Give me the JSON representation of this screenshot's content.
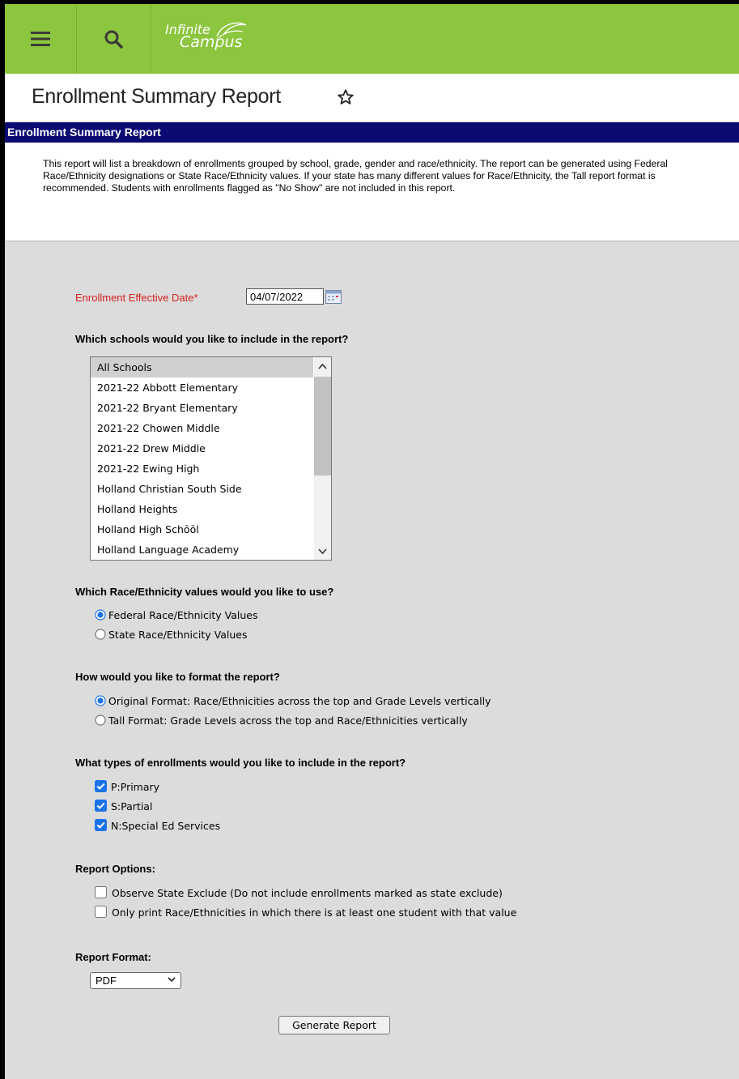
{
  "header": {
    "logo_line1": "Infinite",
    "logo_line2": "Campus",
    "menu_icon": "hamburger-menu-icon",
    "search_icon": "search-icon",
    "brand_color": "#8cc63f"
  },
  "page": {
    "title": "Enrollment Summary Report",
    "favorite_icon": "star-outline-icon"
  },
  "report": {
    "section_title": "Enrollment Summary Report",
    "description": "This report will list a breakdown of enrollments grouped by school, grade, gender and race/ethnicity. The report can be generated using Federal Race/Ethnicity designations or State Race/Ethnicity values. If your state has many different values for Race/Ethnicity, the Tall report format is recommended. Students with enrollments flagged as \"No Show\" are not included in this report."
  },
  "form": {
    "date_label": "Enrollment Effective Date*",
    "date_value": "04/07/2022",
    "schools_question": "Which schools would you like to include in the report?",
    "schools": [
      "All Schools",
      "2021-22 Abbott Elementary",
      "2021-22 Bryant Elementary",
      "2021-22 Chowen Middle",
      "2021-22 Drew Middle",
      "2021-22 Ewing High",
      "Holland Christian South Side",
      "Holland Heights",
      "Holland High Schōōl",
      "Holland Language Academy"
    ],
    "selected_school": "All Schools",
    "race_question": "Which Race/Ethnicity values would you like to use?",
    "race_options": [
      "Federal Race/Ethnicity Values",
      "State Race/Ethnicity Values"
    ],
    "race_selected": "Federal Race/Ethnicity Values",
    "format_question": "How would you like to format the report?",
    "format_options": [
      "Original Format: Race/Ethnicities across the top and Grade Levels vertically",
      "Tall Format: Grade Levels across the top and Race/Ethnicities vertically"
    ],
    "format_selected": "Original Format: Race/Ethnicities across the top and Grade Levels vertically",
    "enrollment_question": "What types of enrollments would you like to include in the report?",
    "enrollment_types": [
      {
        "label": "P:Primary",
        "checked": true
      },
      {
        "label": "S:Partial",
        "checked": true
      },
      {
        "label": "N:Special Ed Services",
        "checked": true
      }
    ],
    "options_heading": "Report Options:",
    "report_options": [
      {
        "label": "Observe State Exclude (Do not include enrollments marked as state exclude)",
        "checked": false
      },
      {
        "label": "Only print Race/Ethnicities in which there is at least one student with that value",
        "checked": false
      }
    ],
    "format_heading": "Report Format:",
    "report_format_value": "PDF",
    "generate_label": "Generate Report"
  }
}
